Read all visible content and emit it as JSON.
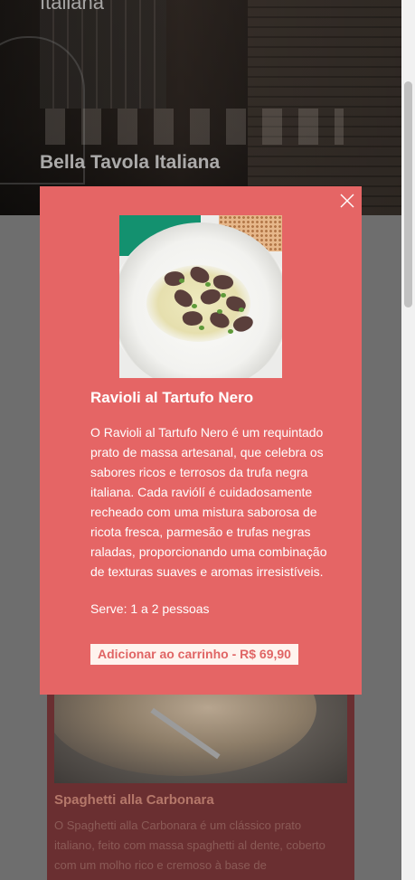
{
  "hero": {
    "subtitle": "Italiana",
    "title": "Bella Tavola Italiana"
  },
  "modal": {
    "close_icon": "close-icon",
    "image_alt": "Ravioli al Tartufo Nero",
    "title": "Ravioli al Tartufo Nero",
    "description": "O Ravioli al Tartufo Nero é um requintado prato de massa artesanal, que celebra os sabores ricos e terrosos da trufa negra italiana. Cada raviólí é cuidadosamente recheado com uma mistura saborosa de ricota fresca, parmesão e trufas negras raladas, proporcionando uma combinação de texturas suaves e aromas irresistíveis.",
    "serves": "Serve: 1 a 2 pessoas",
    "add_to_cart": "Adicionar ao carrinho - R$ 69,90",
    "bg_color": "#e56565"
  },
  "background_card": {
    "title": "Spaghetti alla Carbonara",
    "description": "O Spaghetti alla Carbonara é um clássico prato italiano, feito com massa spaghetti al dente, coberto com um molho rico e cremoso à base de"
  }
}
